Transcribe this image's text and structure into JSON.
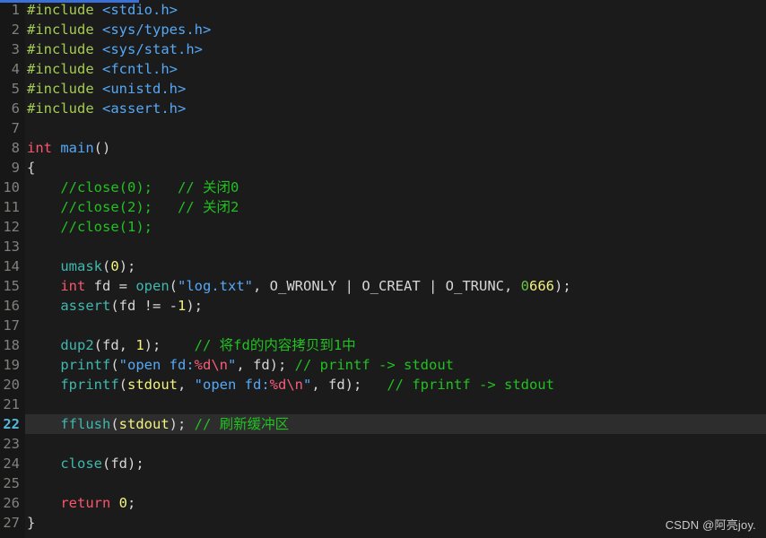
{
  "editor": {
    "language": "c",
    "theme_background": "#1b1b1b",
    "gutter_background": "#171717",
    "active_line_background": "#2d2d2d",
    "active_line_number": 22,
    "total_lines": 27,
    "accent_bar_color": "#3a70d8"
  },
  "watermark": {
    "text": "CSDN @阿亮joy."
  },
  "lines": [
    {
      "n": "1",
      "tokens": [
        {
          "t": "#include ",
          "c": "t-pre"
        },
        {
          "t": "<stdio.h>",
          "c": "t-hdr"
        }
      ]
    },
    {
      "n": "2",
      "tokens": [
        {
          "t": "#include ",
          "c": "t-pre"
        },
        {
          "t": "<sys/types.h>",
          "c": "t-hdr"
        }
      ]
    },
    {
      "n": "3",
      "tokens": [
        {
          "t": "#include ",
          "c": "t-pre"
        },
        {
          "t": "<sys/stat.h>",
          "c": "t-hdr"
        }
      ]
    },
    {
      "n": "4",
      "tokens": [
        {
          "t": "#include ",
          "c": "t-pre"
        },
        {
          "t": "<fcntl.h>",
          "c": "t-hdr"
        }
      ]
    },
    {
      "n": "5",
      "tokens": [
        {
          "t": "#include ",
          "c": "t-pre"
        },
        {
          "t": "<unistd.h>",
          "c": "t-hdr"
        }
      ]
    },
    {
      "n": "6",
      "tokens": [
        {
          "t": "#include ",
          "c": "t-pre"
        },
        {
          "t": "<assert.h>",
          "c": "t-hdr"
        }
      ]
    },
    {
      "n": "7",
      "tokens": []
    },
    {
      "n": "8",
      "tokens": [
        {
          "t": "int ",
          "c": "t-kw"
        },
        {
          "t": "main",
          "c": "t-fn2"
        },
        {
          "t": "()",
          "c": "t-punc"
        }
      ]
    },
    {
      "n": "9",
      "tokens": [
        {
          "t": "{",
          "c": "t-punc"
        }
      ]
    },
    {
      "n": "10",
      "tokens": [
        {
          "t": "    //close(0);   // 关闭0",
          "c": "t-cmt"
        }
      ]
    },
    {
      "n": "11",
      "tokens": [
        {
          "t": "    //close(2);   // 关闭2",
          "c": "t-cmt"
        }
      ]
    },
    {
      "n": "12",
      "tokens": [
        {
          "t": "    //close(1);",
          "c": "t-cmt"
        }
      ]
    },
    {
      "n": "13",
      "tokens": []
    },
    {
      "n": "14",
      "tokens": [
        {
          "t": "    ",
          "c": "t-punc"
        },
        {
          "t": "umask",
          "c": "t-fn"
        },
        {
          "t": "(",
          "c": "t-punc"
        },
        {
          "t": "0",
          "c": "t-num"
        },
        {
          "t": ");",
          "c": "t-punc"
        }
      ]
    },
    {
      "n": "15",
      "tokens": [
        {
          "t": "    ",
          "c": "t-punc"
        },
        {
          "t": "int",
          "c": "t-kw"
        },
        {
          "t": " fd = ",
          "c": "t-punc"
        },
        {
          "t": "open",
          "c": "t-fn"
        },
        {
          "t": "(",
          "c": "t-punc"
        },
        {
          "t": "\"log.txt\"",
          "c": "t-hdr"
        },
        {
          "t": ", ",
          "c": "t-punc"
        },
        {
          "t": "O_WRONLY",
          "c": "t-macro"
        },
        {
          "t": " | ",
          "c": "t-op"
        },
        {
          "t": "O_CREAT",
          "c": "t-macro"
        },
        {
          "t": " | ",
          "c": "t-op"
        },
        {
          "t": "O_TRUNC",
          "c": "t-macro"
        },
        {
          "t": ", ",
          "c": "t-punc"
        },
        {
          "t": "0",
          "c": "t-num0"
        },
        {
          "t": "666",
          "c": "t-num"
        },
        {
          "t": ");",
          "c": "t-punc"
        }
      ]
    },
    {
      "n": "16",
      "tokens": [
        {
          "t": "    ",
          "c": "t-punc"
        },
        {
          "t": "assert",
          "c": "t-fn"
        },
        {
          "t": "(fd != -",
          "c": "t-punc"
        },
        {
          "t": "1",
          "c": "t-num"
        },
        {
          "t": ");",
          "c": "t-punc"
        }
      ]
    },
    {
      "n": "17",
      "tokens": []
    },
    {
      "n": "18",
      "tokens": [
        {
          "t": "    ",
          "c": "t-punc"
        },
        {
          "t": "dup2",
          "c": "t-fn"
        },
        {
          "t": "(fd, ",
          "c": "t-punc"
        },
        {
          "t": "1",
          "c": "t-num"
        },
        {
          "t": ");",
          "c": "t-punc"
        },
        {
          "t": "    // 将fd的内容拷贝到1中",
          "c": "t-cmt"
        }
      ]
    },
    {
      "n": "19",
      "tokens": [
        {
          "t": "    ",
          "c": "t-punc"
        },
        {
          "t": "printf",
          "c": "t-fn"
        },
        {
          "t": "(",
          "c": "t-punc"
        },
        {
          "t": "\"open fd:",
          "c": "t-hdr"
        },
        {
          "t": "%d\\n",
          "c": "t-fmt"
        },
        {
          "t": "\"",
          "c": "t-hdr"
        },
        {
          "t": ", fd);",
          "c": "t-punc"
        },
        {
          "t": " // printf -> stdout",
          "c": "t-cmt"
        }
      ]
    },
    {
      "n": "20",
      "tokens": [
        {
          "t": "    ",
          "c": "t-punc"
        },
        {
          "t": "fprintf",
          "c": "t-fn"
        },
        {
          "t": "(",
          "c": "t-punc"
        },
        {
          "t": "stdout",
          "c": "t-var"
        },
        {
          "t": ", ",
          "c": "t-punc"
        },
        {
          "t": "\"open fd:",
          "c": "t-hdr"
        },
        {
          "t": "%d\\n",
          "c": "t-fmt"
        },
        {
          "t": "\"",
          "c": "t-hdr"
        },
        {
          "t": ", fd);",
          "c": "t-punc"
        },
        {
          "t": "   // fprintf -> stdout",
          "c": "t-cmt"
        }
      ]
    },
    {
      "n": "21",
      "tokens": []
    },
    {
      "n": "22",
      "active": true,
      "tokens": [
        {
          "t": "    ",
          "c": "t-punc"
        },
        {
          "t": "fflush",
          "c": "t-fn"
        },
        {
          "t": "(",
          "c": "t-punc"
        },
        {
          "t": "stdout",
          "c": "t-var"
        },
        {
          "t": ");",
          "c": "t-punc"
        },
        {
          "t": " // 刷新缓冲区",
          "c": "t-cmt"
        }
      ]
    },
    {
      "n": "23",
      "tokens": []
    },
    {
      "n": "24",
      "tokens": [
        {
          "t": "    ",
          "c": "t-punc"
        },
        {
          "t": "close",
          "c": "t-fn"
        },
        {
          "t": "(fd);",
          "c": "t-punc"
        }
      ]
    },
    {
      "n": "25",
      "tokens": []
    },
    {
      "n": "26",
      "tokens": [
        {
          "t": "    ",
          "c": "t-punc"
        },
        {
          "t": "return",
          "c": "t-kw"
        },
        {
          "t": " ",
          "c": "t-punc"
        },
        {
          "t": "0",
          "c": "t-num"
        },
        {
          "t": ";",
          "c": "t-punc"
        }
      ]
    },
    {
      "n": "27",
      "tokens": [
        {
          "t": "}",
          "c": "t-punc"
        }
      ]
    }
  ]
}
